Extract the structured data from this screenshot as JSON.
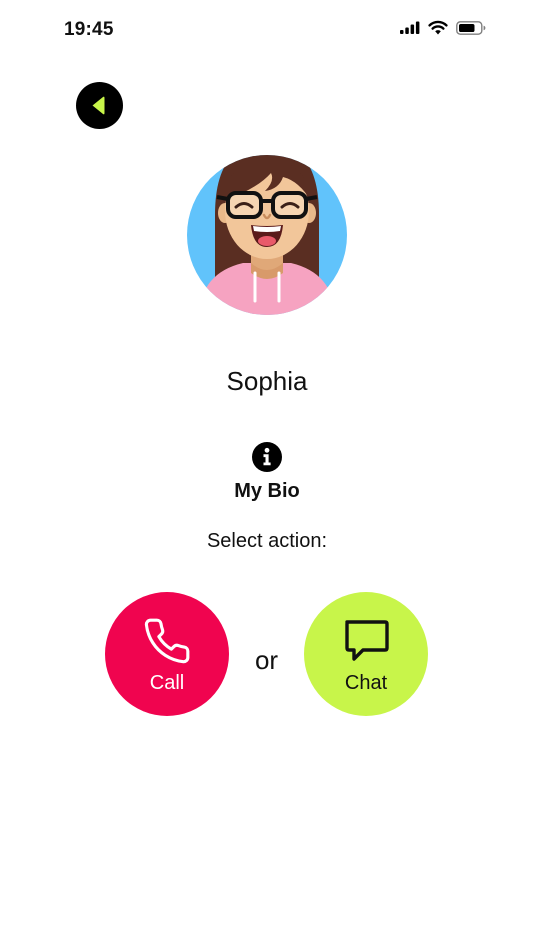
{
  "status_bar": {
    "time": "19:45",
    "icons": [
      "cellular-signal-icon",
      "wifi-icon",
      "battery-icon"
    ]
  },
  "back_button": {
    "icon": "back-arrow-icon",
    "icon_color": "#c8f54a",
    "background": "#000000"
  },
  "contact": {
    "name": "Sophia",
    "avatar_background": "#61c3fb"
  },
  "bio": {
    "icon": "info-icon",
    "label": "My Bio"
  },
  "actions": {
    "prompt": "Select action:",
    "separator": "or",
    "call": {
      "label": "Call",
      "icon": "phone-icon",
      "color": "#f0044f"
    },
    "chat": {
      "label": "Chat",
      "icon": "chat-bubble-icon",
      "color": "#c8f54a"
    }
  }
}
